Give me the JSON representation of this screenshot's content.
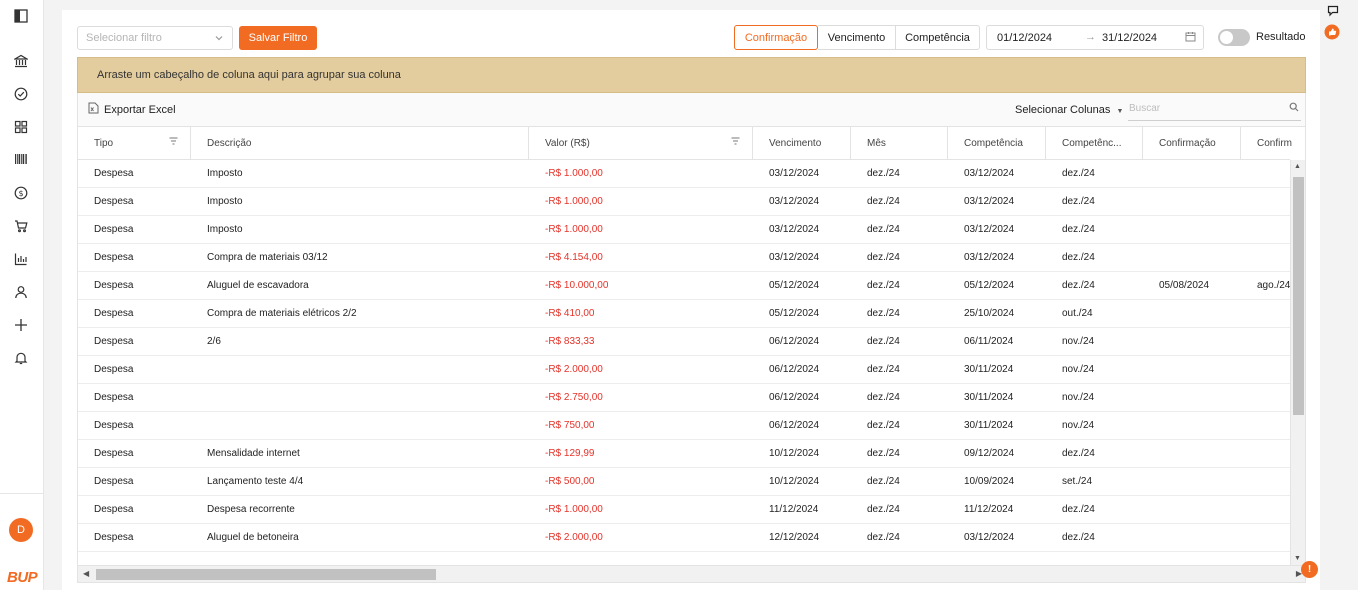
{
  "sidebar": {
    "avatar_initial": "D",
    "brand": "BUP",
    "icons": [
      "panel-toggle-icon",
      "bank-icon",
      "check-circle-icon",
      "grid-icon",
      "barcode-icon",
      "dollar-icon",
      "cart-icon",
      "bar-chart-icon",
      "user-icon",
      "plus-icon",
      "bell-icon"
    ]
  },
  "filters": {
    "select_placeholder": "Selecionar filtro",
    "save_label": "Salvar Filtro",
    "date_modes": [
      "Confirmação",
      "Vencimento",
      "Competência"
    ],
    "active_mode": "Confirmação",
    "date_from": "01/12/2024",
    "date_to": "31/12/2024",
    "date_arrow": "→",
    "toggle_label": "Resultado"
  },
  "grid": {
    "group_hint": "Arraste um cabeçalho de coluna aqui para agrupar sua coluna",
    "export_label": "Exportar Excel",
    "select_columns_label": "Selecionar Colunas",
    "search_placeholder": "Buscar",
    "columns": [
      "Tipo",
      "Descrição",
      "Valor (R$)",
      "Vencimento",
      "Mês",
      "Competência",
      "Competênc...",
      "Confirmação",
      "Confirm"
    ],
    "rows": [
      [
        "Despesa",
        "Imposto",
        "-R$ 1.000,00",
        "03/12/2024",
        "dez./24",
        "03/12/2024",
        "dez./24",
        "",
        ""
      ],
      [
        "Despesa",
        "Imposto",
        "-R$ 1.000,00",
        "03/12/2024",
        "dez./24",
        "03/12/2024",
        "dez./24",
        "",
        ""
      ],
      [
        "Despesa",
        "Imposto",
        "-R$ 1.000,00",
        "03/12/2024",
        "dez./24",
        "03/12/2024",
        "dez./24",
        "",
        ""
      ],
      [
        "Despesa",
        "Compra de materiais 03/12",
        "-R$ 4.154,00",
        "03/12/2024",
        "dez./24",
        "03/12/2024",
        "dez./24",
        "",
        ""
      ],
      [
        "Despesa",
        "Aluguel de escavadora",
        "-R$ 10.000,00",
        "05/12/2024",
        "dez./24",
        "05/12/2024",
        "dez./24",
        "05/08/2024",
        "ago./24"
      ],
      [
        "Despesa",
        "Compra de materiais elétricos 2/2",
        "-R$ 410,00",
        "05/12/2024",
        "dez./24",
        "25/10/2024",
        "out./24",
        "",
        ""
      ],
      [
        "Despesa",
        "2/6",
        "-R$ 833,33",
        "06/12/2024",
        "dez./24",
        "06/11/2024",
        "nov./24",
        "",
        ""
      ],
      [
        "Despesa",
        "",
        "-R$ 2.000,00",
        "06/12/2024",
        "dez./24",
        "30/11/2024",
        "nov./24",
        "",
        ""
      ],
      [
        "Despesa",
        "",
        "-R$ 2.750,00",
        "06/12/2024",
        "dez./24",
        "30/11/2024",
        "nov./24",
        "",
        ""
      ],
      [
        "Despesa",
        "",
        "-R$ 750,00",
        "06/12/2024",
        "dez./24",
        "30/11/2024",
        "nov./24",
        "",
        ""
      ],
      [
        "Despesa",
        "Mensalidade internet",
        "-R$ 129,99",
        "10/12/2024",
        "dez./24",
        "09/12/2024",
        "dez./24",
        "",
        ""
      ],
      [
        "Despesa",
        "Lançamento teste 4/4",
        "-R$ 500,00",
        "10/12/2024",
        "dez./24",
        "10/09/2024",
        "set./24",
        "",
        ""
      ],
      [
        "Despesa",
        "Despesa recorrente",
        "-R$ 1.000,00",
        "11/12/2024",
        "dez./24",
        "11/12/2024",
        "dez./24",
        "",
        ""
      ],
      [
        "Despesa",
        "Aluguel de betoneira",
        "-R$ 2.000,00",
        "12/12/2024",
        "dez./24",
        "03/12/2024",
        "dez./24",
        "",
        ""
      ]
    ]
  },
  "right_rail": {
    "help_badge": "!"
  },
  "colors": {
    "accent": "#f26b22",
    "negative": "#e5332a",
    "group_bar": "#e3cc9d"
  }
}
